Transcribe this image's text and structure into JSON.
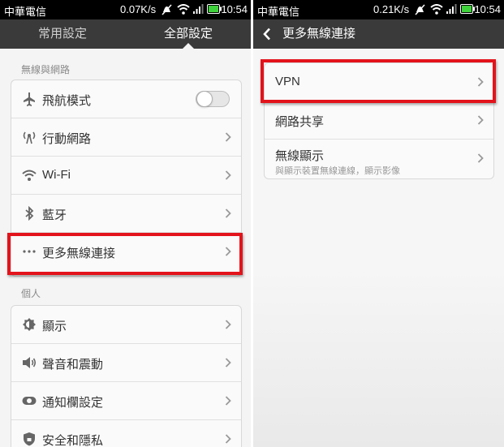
{
  "colors": {
    "highlight": "#e3131b",
    "titlebar": "#3a3a3a"
  },
  "left": {
    "status": {
      "carrier": "中華電信",
      "rate": "0.07K/s",
      "time": "10:54"
    },
    "tabs": [
      {
        "label": "常用設定",
        "active": false
      },
      {
        "label": "全部設定",
        "active": true
      }
    ],
    "sections": [
      {
        "header": "無線與網路",
        "items": [
          {
            "label": "飛航模式",
            "icon": "airplane-icon",
            "control": "toggle",
            "toggle_on": false
          },
          {
            "label": "行動網路",
            "icon": "mobile-network-icon",
            "control": "chevron"
          },
          {
            "label": "Wi-Fi",
            "icon": "wifi-icon",
            "control": "chevron"
          },
          {
            "label": "藍牙",
            "icon": "bluetooth-icon",
            "control": "chevron"
          },
          {
            "label": "更多無線連接",
            "icon": "more-dots-icon",
            "control": "chevron",
            "highlighted": true
          }
        ]
      },
      {
        "header": "個人",
        "items": [
          {
            "label": "顯示",
            "icon": "brightness-icon",
            "control": "chevron"
          },
          {
            "label": "聲音和震動",
            "icon": "speaker-icon",
            "control": "chevron"
          },
          {
            "label": "通知欄設定",
            "icon": "notification-bar-icon",
            "control": "chevron"
          },
          {
            "label": "安全和隱私",
            "icon": "shield-icon",
            "control": "chevron"
          }
        ]
      }
    ]
  },
  "right": {
    "status": {
      "carrier": "中華電信",
      "rate": "0.21K/s",
      "time": "10:54"
    },
    "title": "更多無線連接",
    "items": [
      {
        "label": "VPN",
        "highlighted": true
      },
      {
        "label": "網路共享"
      },
      {
        "label": "無線顯示",
        "sublabel": "與顯示裝置無線連線，顯示影像"
      }
    ]
  }
}
